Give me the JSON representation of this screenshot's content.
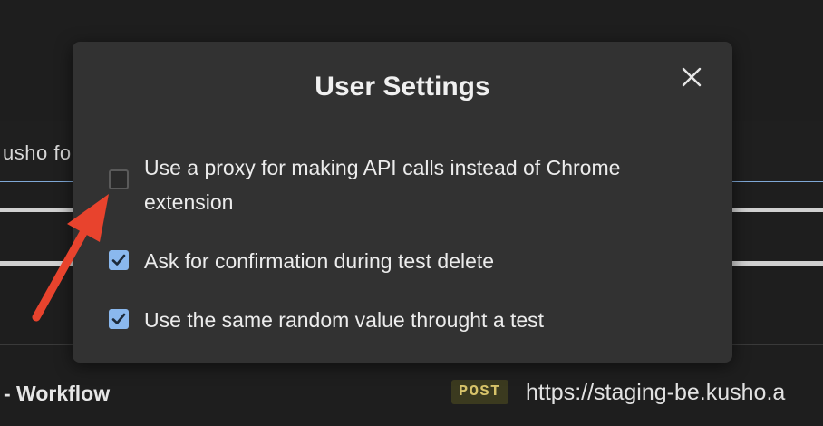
{
  "background": {
    "input_text": "usho fo",
    "workflow_label": "- Workflow",
    "method_badge": "POST",
    "url_text": "https://staging-be.kusho.a"
  },
  "modal": {
    "title": "User Settings",
    "close_icon": "close-icon",
    "options": [
      {
        "label": "Use a proxy for making API calls instead of Chrome extension",
        "checked": false
      },
      {
        "label": "Ask for confirmation during test delete",
        "checked": true
      },
      {
        "label": "Use the same random value throught a test",
        "checked": true
      }
    ]
  },
  "colors": {
    "modal_bg": "#323232",
    "checkbox_checked": "#8ab8ee",
    "annotation_arrow": "#e8432d",
    "method_badge_bg": "#3b3a1f",
    "method_badge_text": "#d7c36a"
  }
}
